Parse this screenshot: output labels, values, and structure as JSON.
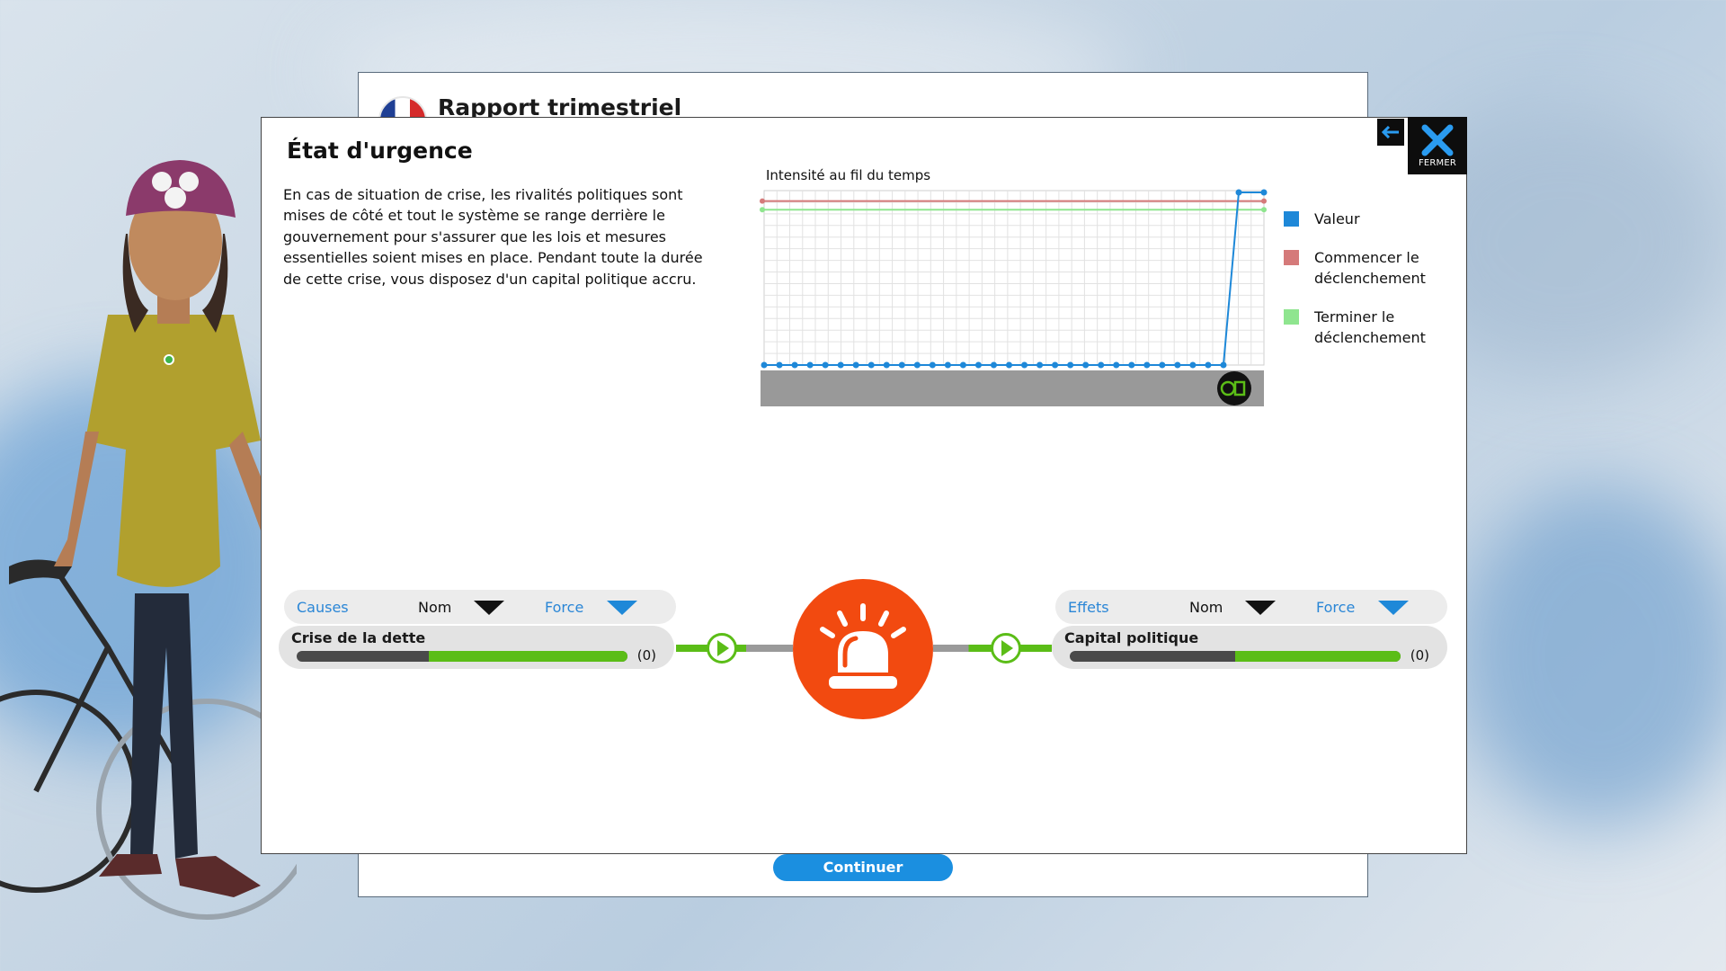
{
  "report": {
    "title": "Rapport trimestriel",
    "continue_label": "Continuer"
  },
  "modal": {
    "title": "État d'urgence",
    "description": "En cas de situation de crise, les rivalités politiques sont mises de côté et tout le système se range derrière le gouvernement pour s'assurer que les lois et mesures essentielles soient mises en place. Pendant toute la durée de cette crise, vous disposez d'un capital politique accru.",
    "close_label": "FERMER"
  },
  "chart_data": {
    "type": "line",
    "title": "Intensité au fil du temps",
    "ylim": [
      0,
      1
    ],
    "series": [
      {
        "name": "Valeur",
        "color": "#1e88d8",
        "values": [
          0,
          0,
          0,
          0,
          0,
          0,
          0,
          0,
          0,
          0,
          0,
          0,
          0,
          0,
          0,
          0,
          0,
          0,
          0,
          0,
          0,
          0,
          0,
          0,
          0,
          0,
          0,
          0,
          0,
          0,
          0,
          1,
          1
        ]
      },
      {
        "name": "Commencer le déclenchement",
        "color": "#d57a7a",
        "values": [
          0.95
        ]
      },
      {
        "name": "Terminer le déclenchement",
        "color": "#8fe58f",
        "values": [
          0.9
        ]
      }
    ],
    "legend_placement": "right",
    "grid": true
  },
  "legend": {
    "items": [
      {
        "label": "Valeur",
        "color": "#1e88d8"
      },
      {
        "label": "Commencer le déclenchement",
        "color": "#d57a7a"
      },
      {
        "label": "Terminer le déclenchement",
        "color": "#8fe58f"
      }
    ]
  },
  "causes": {
    "tab_label": "Causes",
    "sort_name": "Nom",
    "sort_force": "Force",
    "items": [
      {
        "name": "Crise de la dette",
        "count": "(0)",
        "fill": 0.6
      }
    ]
  },
  "effects": {
    "tab_label": "Effets",
    "sort_name": "Nom",
    "sort_force": "Force",
    "items": [
      {
        "name": "Capital politique",
        "count": "(0)",
        "fill": 0.5
      }
    ]
  },
  "colors": {
    "accent": "#1e88d8",
    "siren": "#f24a10",
    "bar_fill": "#5bbd17"
  }
}
